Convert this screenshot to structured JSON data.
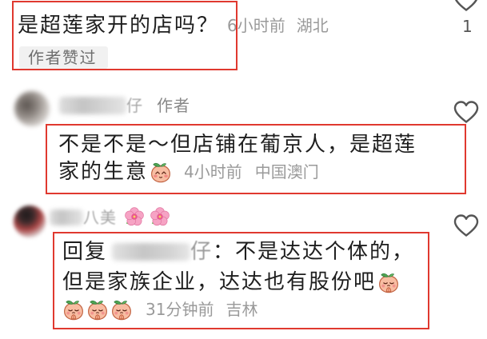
{
  "comments": [
    {
      "text": "是超莲家开的店吗？",
      "time": "6小时前",
      "location": "湖北",
      "like_count": "1",
      "badge": "作者赞过",
      "like_icon": "heart-outline-icon"
    },
    {
      "author_name_tail": "仔",
      "author_tag": "作者",
      "text_lines": [
        "不是不是～但店铺在葡京人，是超莲",
        "家的生意"
      ],
      "emoji": "peach-shy-emoji",
      "time": "4小时前",
      "location": "中国澳门",
      "like_icon": "heart-outline-icon"
    },
    {
      "author_name_tail": "八美",
      "author_emojis": [
        "hibiscus-emoji",
        "hibiscus-emoji"
      ],
      "reply_label": "回复",
      "reply_to_name_tail": "仔",
      "text_lines": [
        "：不是达达个体的，",
        "但是家族企业，达达也有股份吧"
      ],
      "inline_emoji": "peach-pray-emoji",
      "trailing_emojis": [
        "peach-pray-emoji",
        "peach-pray-emoji",
        "peach-pray-emoji"
      ],
      "time": "31分钟前",
      "location": "吉林",
      "like_icon": "heart-outline-icon"
    }
  ],
  "colors": {
    "text": "#1e1e1e",
    "meta": "#9a9a9a",
    "badge_bg": "#f1f1f1",
    "badge_text": "#6f6f6f",
    "annotation": "#e0392f",
    "icon": "#555555"
  }
}
